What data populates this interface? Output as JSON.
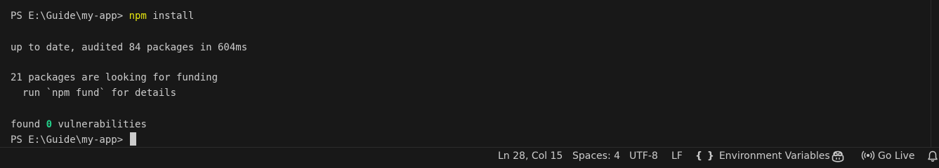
{
  "terminal": {
    "prompt": "PS E:\\Guide\\my-app> ",
    "command": "npm",
    "command_args": " install",
    "output_up_to_date": "up to date, audited 84 packages in 604ms",
    "output_funding_1": "21 packages are looking for funding",
    "output_funding_2": "  run `npm fund` for details",
    "found_prefix": "found ",
    "found_count": "0",
    "found_suffix": " vulnerabilities",
    "prompt_final": "PS E:\\Guide\\my-app> "
  },
  "statusbar": {
    "cursor_position": "Ln 28, Col 15",
    "indentation": "Spaces: 4",
    "encoding": "UTF-8",
    "line_ending": "LF",
    "env_braces": "{ }",
    "env_label": "Environment Variables",
    "go_live_label": "Go Live"
  },
  "icons": {
    "env": "braces-icon",
    "copilot": "copilot-icon",
    "go_live": "broadcast-icon",
    "notifications": "bell-icon"
  },
  "colors": {
    "background": "#181818",
    "text": "#cccccc",
    "command": "#e5e510",
    "success": "#23d18b"
  }
}
